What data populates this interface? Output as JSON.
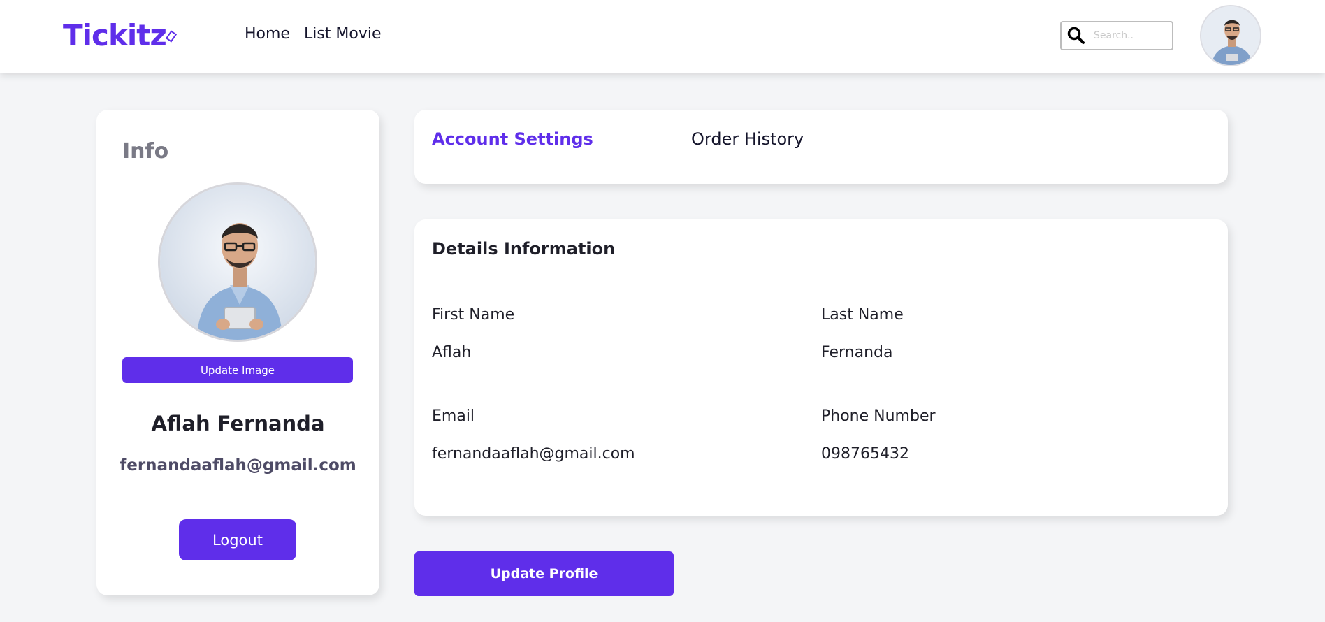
{
  "header": {
    "logo_text": "Tickitz",
    "nav": [
      {
        "label": "Home"
      },
      {
        "label": "List Movie"
      }
    ],
    "search": {
      "placeholder": "Search..",
      "value": ""
    },
    "avatar_icon": "user-avatar-photo"
  },
  "info_card": {
    "title": "Info",
    "photo_icon": "profile-photo",
    "update_image_label": "Update Image",
    "name": "Aflah Fernanda",
    "email": "fernandaaflah@gmail.com",
    "logout_label": "Logout"
  },
  "tabs": [
    {
      "label": "Account Settings",
      "active": true
    },
    {
      "label": "Order History",
      "active": false
    }
  ],
  "details": {
    "title": "Details Information",
    "fields": [
      {
        "label": "First Name",
        "value": "Aflah"
      },
      {
        "label": "Last Name",
        "value": "Fernanda"
      },
      {
        "label": "Email",
        "value": "fernandaaflah@gmail.com"
      },
      {
        "label": "Phone Number",
        "value": "098765432"
      }
    ]
  },
  "update_profile_label": "Update Profile",
  "colors": {
    "accent": "#5f2eea",
    "background": "#f4f5f7",
    "card": "#ffffff",
    "text": "#14142b",
    "muted": "#7a7a86"
  }
}
